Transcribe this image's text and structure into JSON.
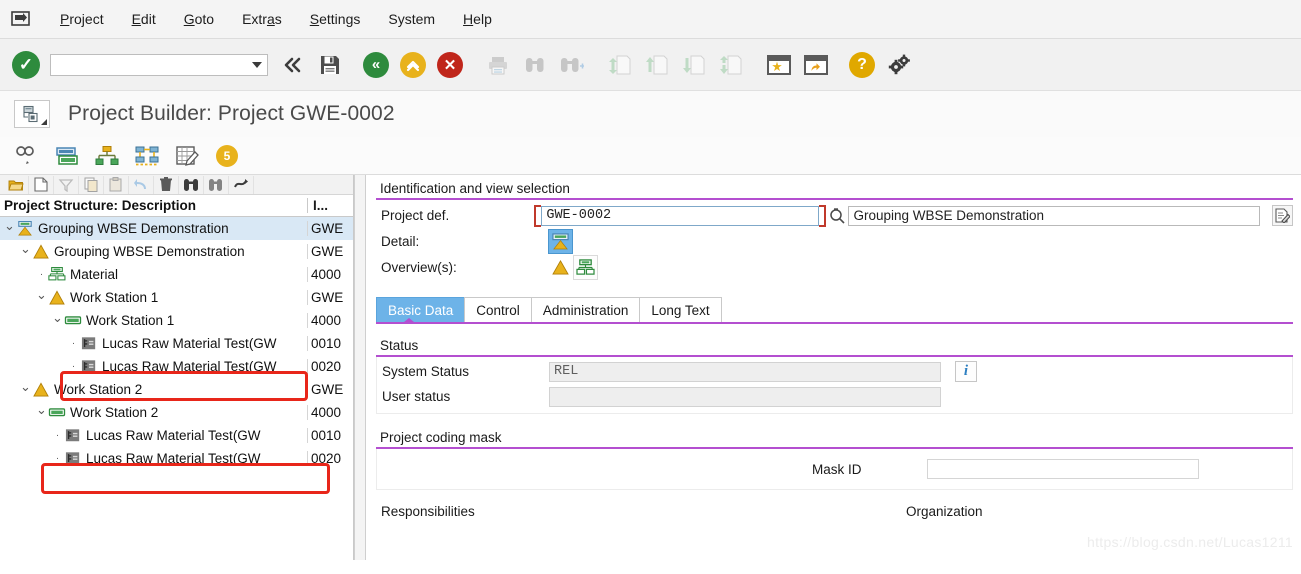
{
  "menubar": {
    "system_icon": "sap-system-menu-icon",
    "items": [
      {
        "label": "Project",
        "accel": "P"
      },
      {
        "label": "Edit",
        "accel": "E"
      },
      {
        "label": "Goto",
        "accel": "G"
      },
      {
        "label": "Extras",
        "accel": "a"
      },
      {
        "label": "Settings",
        "accel": "S"
      },
      {
        "label": "System",
        "accel": ""
      },
      {
        "label": "Help",
        "accel": "H"
      }
    ]
  },
  "toolbar": {
    "enter_icon": "green-check-circle-icon",
    "command_field_value": "",
    "command_field_placeholder": "",
    "dropdown_icon": "chevron-down-icon",
    "buttons": [
      {
        "name": "back-chevrons-icon",
        "glyph": "«",
        "enabled": true
      },
      {
        "name": "save-icon",
        "glyph": "floppy",
        "enabled": true
      },
      {
        "name": "back-icon",
        "glyph": "«",
        "enabled": true
      },
      {
        "name": "exit-icon",
        "glyph": "»",
        "enabled": true
      },
      {
        "name": "cancel-icon",
        "glyph": "✕",
        "enabled": true
      },
      {
        "name": "print-icon",
        "glyph": "printer",
        "enabled": false
      },
      {
        "name": "find-icon",
        "glyph": "binoculars",
        "enabled": false
      },
      {
        "name": "find-next-icon",
        "glyph": "binoculars-plus",
        "enabled": false
      },
      {
        "name": "first-page-icon",
        "glyph": "page-up",
        "enabled": false
      },
      {
        "name": "previous-page-icon",
        "glyph": "page-prev",
        "enabled": false
      },
      {
        "name": "next-page-icon",
        "glyph": "page-next",
        "enabled": false
      },
      {
        "name": "last-page-icon",
        "glyph": "page-down",
        "enabled": false
      },
      {
        "name": "create-session-icon",
        "glyph": "window-star",
        "enabled": true
      },
      {
        "name": "create-shortcut-icon",
        "glyph": "window-arrow",
        "enabled": true
      },
      {
        "name": "help-icon",
        "glyph": "?",
        "enabled": true
      },
      {
        "name": "customize-icon",
        "glyph": "gears",
        "enabled": true
      }
    ]
  },
  "title": {
    "icon": "project-builder-icon",
    "text": "Project Builder: Project GWE-0002"
  },
  "app_toolbar": {
    "buttons": [
      {
        "name": "display-change-icon",
        "glyph": "glasses-pencil"
      },
      {
        "name": "project-definition-icon",
        "glyph": "blue-green-card"
      },
      {
        "name": "hierarchy-graphic-icon",
        "glyph": "org-tree"
      },
      {
        "name": "network-graphic-icon",
        "glyph": "network"
      },
      {
        "name": "project-planning-board-icon",
        "glyph": "table-pencil"
      },
      {
        "name": "messages-icon",
        "glyph": "5",
        "badge": "5"
      }
    ]
  },
  "tree_panel": {
    "toolbar_buttons": [
      {
        "name": "open-project-icon",
        "glyph": "folder-open"
      },
      {
        "name": "new-document-icon",
        "glyph": "page"
      },
      {
        "name": "filter-icon",
        "glyph": "funnel"
      },
      {
        "name": "copy-icon",
        "glyph": "copy"
      },
      {
        "name": "paste-icon",
        "glyph": "clipboard"
      },
      {
        "name": "undo-icon",
        "glyph": "undo-arrow"
      },
      {
        "name": "delete-icon",
        "glyph": "trash"
      },
      {
        "name": "find-icon",
        "glyph": "binoculars"
      },
      {
        "name": "find-next-icon",
        "glyph": "binoculars-next"
      },
      {
        "name": "more-icon",
        "glyph": "more-arrow"
      }
    ],
    "columns": [
      "Project Structure: Description",
      "I..."
    ],
    "rows": [
      {
        "depth": 0,
        "expander": "expanded",
        "icon": "project-definition-icon",
        "label": "Grouping WBSE Demonstration",
        "id": "GWE",
        "selected": true
      },
      {
        "depth": 1,
        "expander": "expanded",
        "icon": "wbs-element-icon",
        "label": "Grouping WBSE Demonstration",
        "id": "GWE",
        "selected": false
      },
      {
        "depth": 2,
        "expander": "leaf",
        "icon": "material-icon",
        "label": "Material",
        "id": "4000",
        "selected": false
      },
      {
        "depth": 2,
        "expander": "expanded",
        "icon": "wbs-element-icon",
        "label": "Work Station 1",
        "id": "GWE",
        "selected": false
      },
      {
        "depth": 3,
        "expander": "expanded",
        "icon": "activity-icon",
        "label": "Work Station 1",
        "id": "4000",
        "selected": false
      },
      {
        "depth": 4,
        "expander": "leaf",
        "icon": "component-icon",
        "label": "Lucas Raw Material Test(GW",
        "id": "0010",
        "selected": false
      },
      {
        "depth": 4,
        "expander": "leaf",
        "icon": "component-icon",
        "label": "Lucas Raw Material Test(GW",
        "id": "0020",
        "selected": false
      },
      {
        "depth": 1,
        "expander": "expanded",
        "icon": "wbs-element-icon",
        "label": "Work Station 2",
        "id": "GWE",
        "selected": false
      },
      {
        "depth": 2,
        "expander": "expanded",
        "icon": "activity-icon",
        "label": "Work Station 2",
        "id": "4000",
        "selected": false
      },
      {
        "depth": 3,
        "expander": "leaf",
        "icon": "component-icon",
        "label": "Lucas Raw Material Test(GW",
        "id": "0010",
        "selected": false
      },
      {
        "depth": 3,
        "expander": "leaf",
        "icon": "component-icon",
        "label": "Lucas Raw Material Test(GW",
        "id": "0020",
        "selected": false
      }
    ]
  },
  "identification": {
    "section_title": "Identification and view selection",
    "project_def": {
      "label": "Project def.",
      "value": "GWE-0002",
      "search_help_icon": "search-help-icon",
      "description_value": "Grouping WBSE Demonstration",
      "long_text_icon": "long-text-editor-icon"
    },
    "detail": {
      "label": "Detail:",
      "buttons": [
        {
          "name": "detail-project-definition-button",
          "icon": "project-definition-icon",
          "active": true
        }
      ]
    },
    "overviews": {
      "label": "Overview(s):",
      "buttons": [
        {
          "name": "overview-wbs-element-button",
          "icon": "wbs-element-icon",
          "active": false
        },
        {
          "name": "overview-material-button",
          "icon": "material-icon",
          "active": false
        }
      ]
    }
  },
  "tabs": [
    {
      "label": "Basic Data",
      "active": true
    },
    {
      "label": "Control",
      "active": false
    },
    {
      "label": "Administration",
      "active": false
    },
    {
      "label": "Long Text",
      "active": false
    }
  ],
  "status_section": {
    "title": "Status",
    "rows": [
      {
        "label": "System Status",
        "value": "REL",
        "readonly": true
      },
      {
        "label": "User status",
        "value": "",
        "readonly": true
      }
    ],
    "info_icon": "info-icon"
  },
  "coding_mask_section": {
    "title": "Project coding mask",
    "mask_id_label": "Mask ID",
    "mask_id_value": ""
  },
  "bottom_section": {
    "responsibilities_title": "Responsibilities",
    "organization_title": "Organization"
  },
  "watermark": "https://blog.csdn.net/Lucas1211",
  "colors": {
    "accent_purple": "#b44fd0",
    "tab_active_blue": "#6db3e8",
    "tree_selection": "#d9e8f5",
    "annotation_red": "#e8261a",
    "ok_green": "#2e8b3d",
    "warn_yellow": "#e0a800",
    "error_red": "#c0261b"
  }
}
